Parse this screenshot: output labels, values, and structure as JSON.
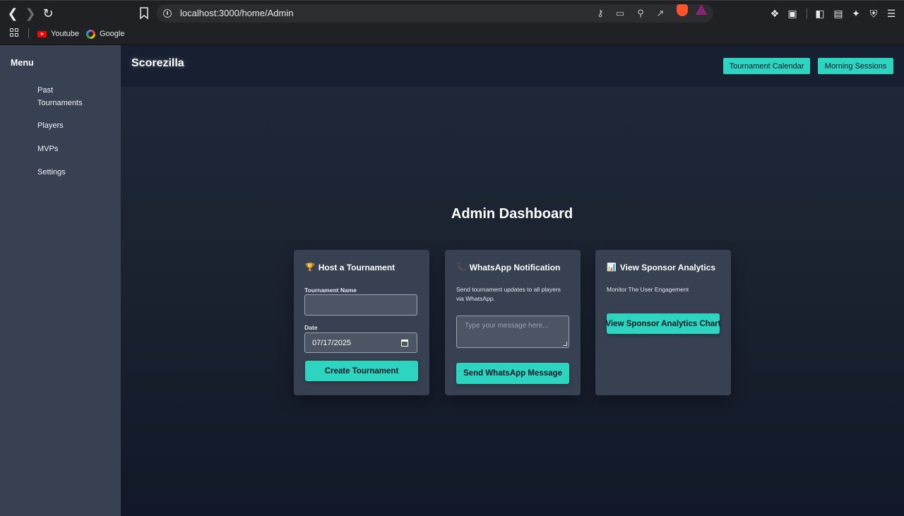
{
  "browser": {
    "url": "localhost:3000/home/Admin",
    "bookmarks": [
      {
        "label": "Youtube"
      },
      {
        "label": "Google"
      }
    ]
  },
  "app": {
    "brand": "Scorezilla",
    "header_buttons": {
      "calendar": "Tournament Calendar",
      "morning": "Morning Sessions"
    },
    "sidebar": {
      "title": "Menu",
      "items": [
        {
          "label": "Past Tournaments"
        },
        {
          "label": "Players"
        },
        {
          "label": "MVPs"
        },
        {
          "label": "Settings"
        }
      ]
    },
    "page_title": "Admin Dashboard",
    "cards": {
      "host": {
        "icon": "trophy-icon",
        "title": "Host a Tournament",
        "name_label": "Tournament Name",
        "name_value": "",
        "date_label": "Date",
        "date_value": "07/17/2025",
        "button": "Create Tournament"
      },
      "whatsapp": {
        "icon": "phone-icon",
        "title": "WhatsApp Notification",
        "description": "Send tournament updates to all players via WhatsApp.",
        "placeholder": "Type your message here...",
        "button": "Send WhatsApp Message"
      },
      "sponsor": {
        "icon": "bar-chart-icon",
        "title": "View Sponsor Analytics",
        "description": "Monitor The User Engagement",
        "button": "View Sponsor Analytics Chart"
      }
    },
    "colors": {
      "accent": "#2dd4bf",
      "sidebar": "#374151",
      "card": "#374151",
      "background": "#1f2937"
    }
  }
}
